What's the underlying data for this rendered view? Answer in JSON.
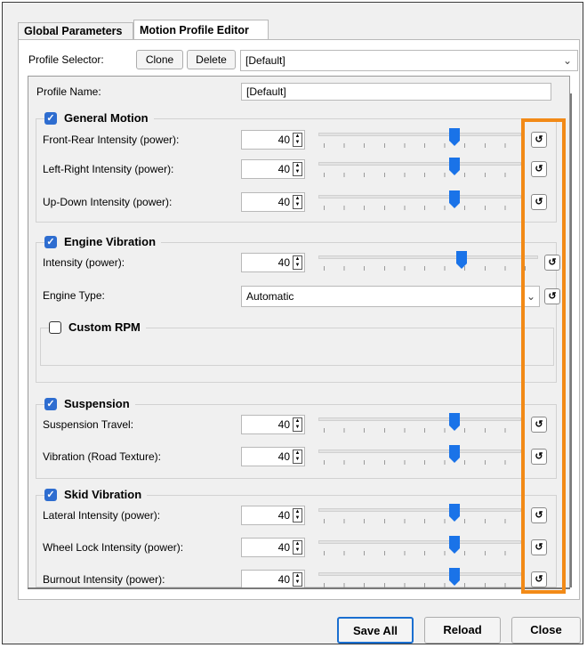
{
  "tabs": [
    {
      "label": "Global Parameters",
      "active": false
    },
    {
      "label": "Motion Profile Editor",
      "active": true
    }
  ],
  "profile_selector": {
    "label": "Profile Selector:",
    "clone_label": "Clone",
    "delete_label": "Delete",
    "selected": "[Default]"
  },
  "profile_name": {
    "label": "Profile Name:",
    "value": "[Default]"
  },
  "general_motion": {
    "title": "General Motion",
    "checked": true,
    "rows": [
      {
        "label": "Front-Rear Intensity (power):",
        "value": "40",
        "level": 0.67
      },
      {
        "label": "Left-Right Intensity (power):",
        "value": "40",
        "level": 0.67
      },
      {
        "label": "Up-Down Intensity (power):",
        "value": "40",
        "level": 0.67
      }
    ]
  },
  "engine_vibration": {
    "title": "Engine Vibration",
    "checked": true,
    "intensity": {
      "label": "Intensity (power):",
      "value": "40",
      "level": 0.65
    },
    "engine_type": {
      "label": "Engine Type:",
      "value": "Automatic"
    },
    "custom_rpm": {
      "title": "Custom RPM",
      "checked": false
    }
  },
  "suspension": {
    "title": "Suspension",
    "checked": true,
    "rows": [
      {
        "label": "Suspension Travel:",
        "value": "40",
        "level": 0.67
      },
      {
        "label": "Vibration (Road Texture):",
        "value": "40",
        "level": 0.67
      }
    ]
  },
  "skid_vibration": {
    "title": "Skid Vibration",
    "checked": true,
    "rows": [
      {
        "label": "Lateral Intensity (power):",
        "value": "40",
        "level": 0.67
      },
      {
        "label": "Wheel Lock Intensity (power):",
        "value": "40",
        "level": 0.67
      },
      {
        "label": "Burnout Intensity (power):",
        "value": "40",
        "level": 0.67
      }
    ]
  },
  "footer": {
    "save_all": "Save All",
    "reload": "Reload",
    "close": "Close"
  },
  "icons": {
    "reset": "reset-icon",
    "check": "checkmark-icon"
  },
  "colors": {
    "accent": "#2e6dd0",
    "highlight_box": "#f28a17",
    "slider_thumb": "#1a73e8"
  }
}
